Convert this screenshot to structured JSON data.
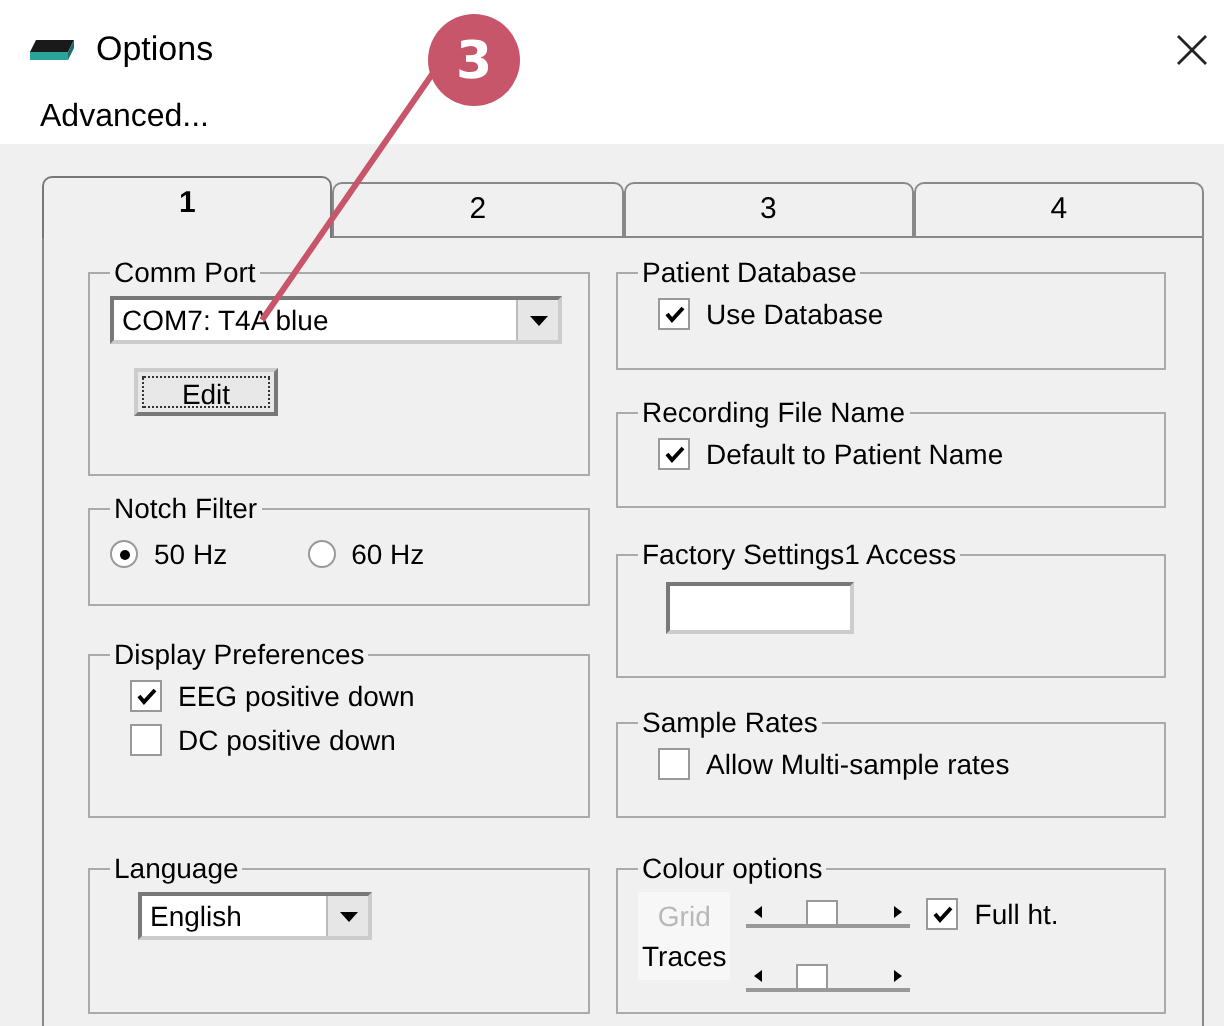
{
  "window": {
    "title": "Options"
  },
  "menu": [
    "Advanced..."
  ],
  "callout": {
    "label": "3"
  },
  "tabs": [
    {
      "label": "1",
      "selected": true
    },
    {
      "label": "2",
      "selected": false
    },
    {
      "label": "3",
      "selected": false
    },
    {
      "label": "4",
      "selected": false
    }
  ],
  "left_groups": [
    {
      "title": "Comm Port",
      "items": [
        {
          "kind": "combo",
          "value": "COM7: T4A blue"
        },
        {
          "kind": "button",
          "label": "Edit"
        }
      ]
    },
    {
      "title": "Notch Filter",
      "items": [
        {
          "kind": "radios",
          "options": [
            {
              "label": "50 Hz",
              "selected": true
            },
            {
              "label": "60 Hz",
              "selected": false
            }
          ]
        }
      ]
    },
    {
      "title": "Display Preferences",
      "items": [
        {
          "kind": "checkbox",
          "label": "EEG positive down",
          "checked": true
        },
        {
          "kind": "checkbox",
          "label": "DC positive down",
          "checked": false
        }
      ]
    },
    {
      "title": "Language",
      "items": [
        {
          "kind": "combo",
          "value": "English"
        }
      ]
    }
  ],
  "right_groups": [
    {
      "title": "Patient Database",
      "items": [
        {
          "kind": "checkbox",
          "label": "Use Database",
          "checked": true
        }
      ]
    },
    {
      "title": "Recording File Name",
      "items": [
        {
          "kind": "checkbox",
          "label": "Default to Patient Name",
          "checked": true
        }
      ]
    },
    {
      "title": "Factory Settings1 Access",
      "items": [
        {
          "kind": "textbox"
        }
      ]
    },
    {
      "title": "Sample Rates",
      "items": [
        {
          "kind": "checkbox",
          "label": "Allow Multi-sample rates",
          "checked": false
        }
      ]
    },
    {
      "title": "Colour options",
      "items": [
        {
          "kind": "colour",
          "grid_label": "Grid",
          "traces_label": "Traces",
          "grid": {
            "level": 0.45
          },
          "traces": {
            "level": 0.35
          },
          "full": {
            "label": "Full ht.",
            "checked": true
          }
        }
      ]
    }
  ]
}
